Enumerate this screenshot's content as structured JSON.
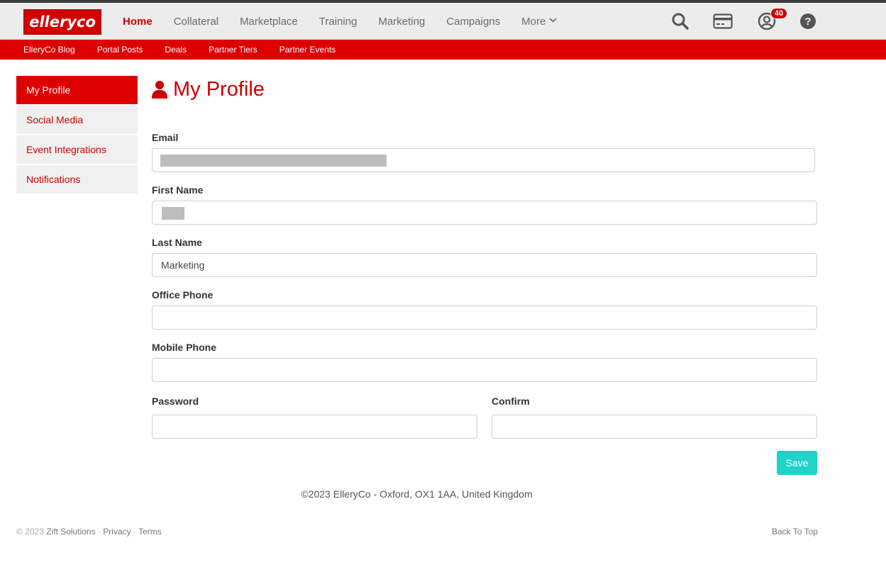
{
  "brand": {
    "logo_text": "elleryco",
    "accent": "#dd0000",
    "save_color": "#1ed3c8"
  },
  "main_nav": {
    "home": "Home",
    "collateral": "Collateral",
    "marketplace": "Marketplace",
    "training": "Training",
    "marketing": "Marketing",
    "campaigns": "Campaigns",
    "more": "More"
  },
  "nav_icons": {
    "search": "search-icon",
    "card": "credit-card-icon",
    "user": "user-icon",
    "help": "help-icon",
    "notification_count": "40"
  },
  "sub_nav": {
    "blog": "ElleryCo Blog",
    "portal_posts": "Portal Posts",
    "deals": "Deals",
    "partner_tiers": "Partner Tiers",
    "partner_events": "Partner Events"
  },
  "sidebar": {
    "my_profile": "My Profile",
    "social_media": "Social Media",
    "event_integrations": "Event Integrations",
    "notifications": "Notifications"
  },
  "page": {
    "title": "My Profile"
  },
  "form": {
    "email_label": "Email",
    "email_value": "",
    "first_name_label": "First Name",
    "first_name_value": "",
    "last_name_label": "Last Name",
    "last_name_value": "Marketing",
    "office_phone_label": "Office Phone",
    "office_phone_value": "",
    "mobile_phone_label": "Mobile Phone",
    "mobile_phone_value": "",
    "password_label": "Password",
    "confirm_label": "Confirm",
    "save_label": "Save"
  },
  "footer": {
    "copyright": "©2023 ElleryCo - Oxford, OX1 1AA, United Kingdom",
    "zift_prefix": "© 2023",
    "zift": "Zift Solutions",
    "sep": "·",
    "privacy": "Privacy",
    "terms": "Terms",
    "back_to_top": "Back To Top"
  }
}
